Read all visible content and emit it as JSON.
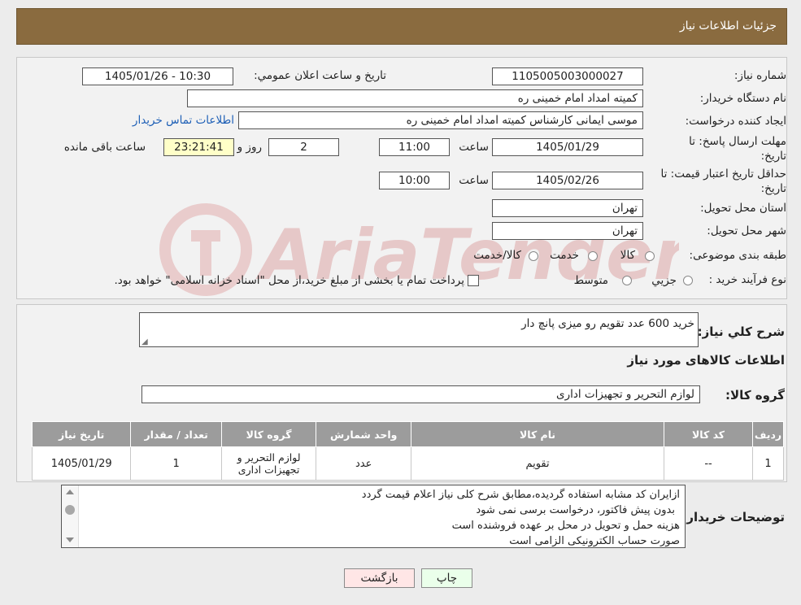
{
  "header": {
    "title": "جزئیات اطلاعات نیاز"
  },
  "form": {
    "need_number_label": "شماره نیاز:",
    "need_number": "1105005003000027",
    "announce_label": "تاریخ و ساعت اعلان عمومي:",
    "announce_value": "1405/01/26 - 10:30",
    "buyer_org_label": "نام دستگاه خریدار:",
    "buyer_org": "کمیته امداد امام خمینی ره",
    "creator_label": "ایجاد کننده درخواست:",
    "creator": "موسی ایمانی کارشناس کمیته امداد امام خمینی ره",
    "contact_link": "اطلاعات تماس خریدار",
    "deadline_label_1": "مهلت ارسال پاسخ: تا",
    "deadline_label_2": "تاریخ:",
    "deadline_date": "1405/01/29",
    "time_label": "ساعت",
    "deadline_time": "11:00",
    "days": "2",
    "days_label": "روز و",
    "remaining_time": "23:21:41",
    "remaining_label": "ساعت باقی مانده",
    "validity_label_1": "حداقل تاریخ اعتبار قیمت: تا",
    "validity_label_2": "تاریخ:",
    "validity_date": "1405/02/26",
    "validity_time": "10:00",
    "province_label": "استان محل تحویل:",
    "province": "تهران",
    "city_label": "شهر محل تحویل:",
    "city": "تهران",
    "category_label": "طبقه بندی موضوعی:",
    "category_options": [
      "کالا",
      "خدمت",
      "کالا/خدمت"
    ],
    "process_label": "نوع فرآیند خرید :",
    "process_options": [
      "جزیي",
      "متوسط"
    ],
    "process_note": "پرداخت تمام یا بخشی از مبلغ خرید،از محل \"اسناد خزانه اسلامی\" خواهد بود."
  },
  "summary": {
    "desc_label": "شرح کلي نیاز:",
    "desc_value": "خرید 600 عدد تقویم رو میزی پانچ دار",
    "goods_info_title": "اطلاعات کالاهای مورد نیاز",
    "group_label": "گروه کالا:",
    "group_value": "لوازم التحریر و تجهیزات اداری"
  },
  "table": {
    "headers": [
      "ردیف",
      "کد کالا",
      "نام کالا",
      "واحد شمارش",
      "گروه کالا",
      "تعداد / مقدار",
      "تاریخ نیاز"
    ],
    "rows": [
      {
        "row": "1",
        "code": "--",
        "name": "تقویم",
        "unit": "عدد",
        "group": "لوازم التحریر و تجهیزات اداری",
        "qty": "1",
        "date": "1405/01/29"
      }
    ]
  },
  "notes": {
    "label": "توضیحات خریدار:",
    "lines": [
      "ازایران کد مشابه استفاده گردیده،مطابق شرح کلی نیاز اعلام قیمت گردد",
      "بدون پیش فاکتور، درخواست برسی نمی شود",
      "هزینه حمل و تحویل در محل بر عهده فروشنده است",
      "صورت حساب الکترونیکی الزامی است"
    ]
  },
  "buttons": {
    "print": "چاپ",
    "back": "بازگشت"
  },
  "watermark": {
    "text": "AriaTender.neT"
  },
  "colors": {
    "header_bg": "#8a6b3f",
    "link": "#1d5fb6",
    "print_btn": "#eaffea",
    "back_btn": "#ffe6e6"
  }
}
